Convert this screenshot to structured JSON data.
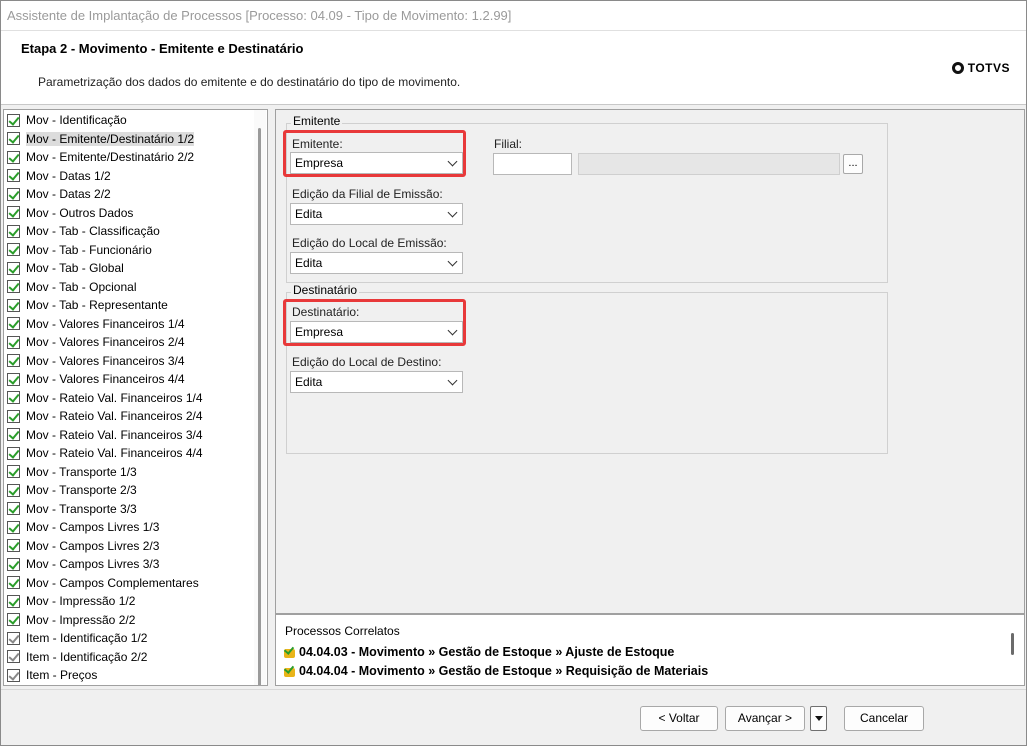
{
  "window": {
    "title": "Assistente de Implantação de Processos [Processo: 04.09 - Tipo de Movimento: 1.2.99]"
  },
  "header": {
    "step_title": "Etapa 2 - Movimento - Emitente e Destinatário",
    "step_description": "Parametrização dos dados do emitente e do destinatário do tipo de movimento.",
    "logo_text": "TOTVS"
  },
  "nav": {
    "items": [
      {
        "label": "Mov - Identificação"
      },
      {
        "label": "Mov - Emitente/Destinatário 1/2",
        "selected": true
      },
      {
        "label": "Mov - Emitente/Destinatário 2/2"
      },
      {
        "label": "Mov - Datas 1/2"
      },
      {
        "label": "Mov - Datas 2/2"
      },
      {
        "label": "Mov - Outros Dados"
      },
      {
        "label": "Mov - Tab - Classificação"
      },
      {
        "label": "Mov - Tab - Funcionário"
      },
      {
        "label": "Mov - Tab - Global"
      },
      {
        "label": "Mov - Tab - Opcional"
      },
      {
        "label": "Mov - Tab - Representante"
      },
      {
        "label": "Mov - Valores Financeiros 1/4"
      },
      {
        "label": "Mov - Valores Financeiros 2/4"
      },
      {
        "label": "Mov - Valores Financeiros 3/4"
      },
      {
        "label": "Mov - Valores Financeiros 4/4"
      },
      {
        "label": "Mov - Rateio Val. Financeiros 1/4"
      },
      {
        "label": "Mov - Rateio Val. Financeiros 2/4"
      },
      {
        "label": "Mov - Rateio Val. Financeiros 3/4"
      },
      {
        "label": "Mov - Rateio Val. Financeiros 4/4"
      },
      {
        "label": "Mov - Transporte 1/3"
      },
      {
        "label": "Mov - Transporte 2/3"
      },
      {
        "label": "Mov - Transporte 3/3"
      },
      {
        "label": "Mov - Campos Livres 1/3"
      },
      {
        "label": "Mov - Campos Livres 2/3"
      },
      {
        "label": "Mov - Campos Livres 3/3"
      },
      {
        "label": "Mov - Campos Complementares"
      },
      {
        "label": "Mov - Impressão 1/2"
      },
      {
        "label": "Mov - Impressão 2/2"
      },
      {
        "label": "Item - Identificação 1/2",
        "plain": true
      },
      {
        "label": "Item - Identificação 2/2",
        "plain": true
      },
      {
        "label": "Item - Preços",
        "plain": true
      }
    ]
  },
  "emitente_group": {
    "legend": "Emitente",
    "emitente_label": "Emitente:",
    "emitente_value": "Empresa",
    "filial_label": "Filial:",
    "edicao_filial_label": "Edição da Filial de Emissão:",
    "edicao_filial_value": "Edita",
    "edicao_local_label": "Edição do Local de Emissão:",
    "edicao_local_value": "Edita",
    "lookup_label": "..."
  },
  "destinatario_group": {
    "legend": "Destinatário",
    "destinatario_label": "Destinatário:",
    "destinatario_value": "Empresa",
    "edicao_destino_label": "Edição do Local de Destino:",
    "edicao_destino_value": "Edita"
  },
  "related": {
    "title": "Processos Correlatos",
    "items": [
      "04.04.03 - Movimento » Gestão de Estoque » Ajuste de Estoque",
      "04.04.04 - Movimento » Gestão de Estoque » Requisição de Materiais"
    ]
  },
  "footer": {
    "back_label": "< Voltar",
    "next_label": "Avançar >",
    "cancel_label": "Cancelar"
  },
  "colors": {
    "highlight": "#e8393a",
    "check": "#2a9d2a"
  }
}
